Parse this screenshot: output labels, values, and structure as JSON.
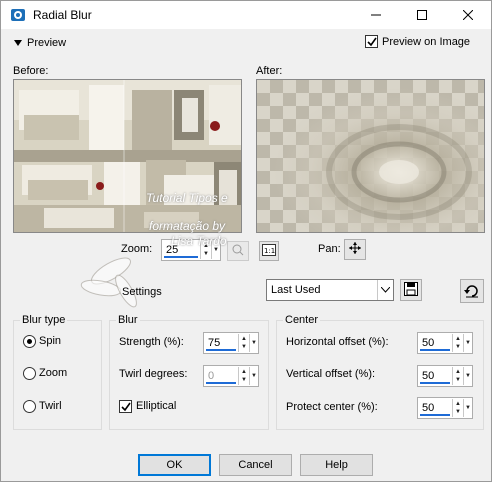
{
  "window": {
    "title": "Radial Blur",
    "minimize_icon": "minimize-icon",
    "maximize_icon": "maximize-icon",
    "close_icon": "close-icon"
  },
  "preview": {
    "toggle_label": "Preview",
    "preview_on_image_label": "Preview on Image",
    "preview_on_image_checked": true,
    "before_label": "Before:",
    "after_label": "After:",
    "zoom_label": "Zoom:",
    "zoom_value": "25",
    "pan_label": "Pan:",
    "watermark_line1": "Tutorial Tipos e",
    "watermark_line2": "formatação by",
    "watermark_line3": "Lisa Tardo"
  },
  "settings": {
    "label": "Settings",
    "preset_value": "Last Used"
  },
  "blur_type": {
    "title": "Blur type",
    "options": [
      "Spin",
      "Zoom",
      "Twirl"
    ],
    "selected": "Spin"
  },
  "blur": {
    "title": "Blur",
    "strength_label": "Strength (%):",
    "strength_value": "75",
    "twirl_label": "Twirl degrees:",
    "twirl_value": "0",
    "elliptical_label": "Elliptical",
    "elliptical_checked": true
  },
  "center": {
    "title": "Center",
    "h_offset_label": "Horizontal offset (%):",
    "h_offset_value": "50",
    "v_offset_label": "Vertical offset (%):",
    "v_offset_value": "50",
    "protect_label": "Protect center (%):",
    "protect_value": "50"
  },
  "buttons": {
    "ok": "OK",
    "cancel": "Cancel",
    "help": "Help"
  },
  "colors": {
    "accent": "#0078d7",
    "underline": "#1e6bd6"
  }
}
